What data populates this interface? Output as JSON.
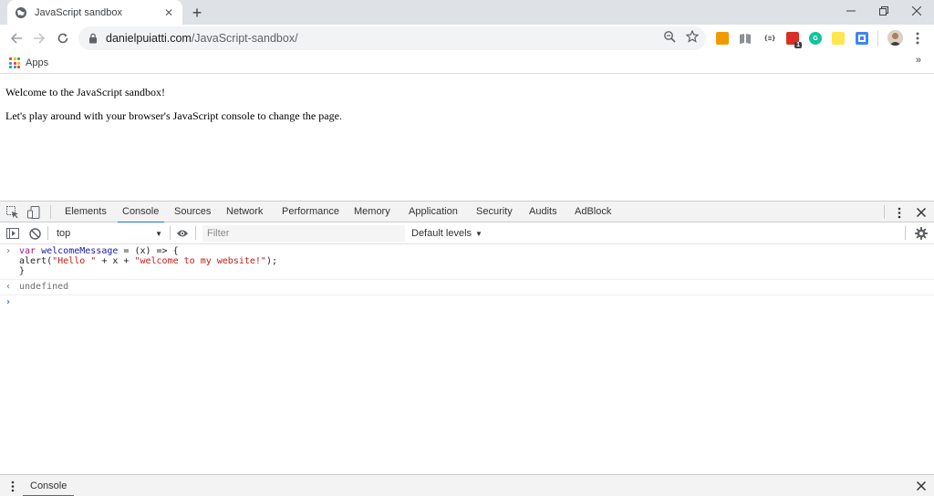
{
  "browser": {
    "tab": {
      "title": "JavaScript sandbox",
      "close": "✕"
    },
    "newtab": "+",
    "window": {
      "minimize": "—",
      "restore": "❐",
      "close": "✕"
    },
    "address": {
      "domain": "danielpuiatti.com",
      "path": "/JavaScript-sandbox/"
    },
    "bookmarks": {
      "apps_label": "Apps",
      "more": "»"
    },
    "extensions": [
      {
        "name": "orange-ext",
        "color": "#f29900",
        "text": ""
      },
      {
        "name": "book-ext",
        "color": "#9aa0a6",
        "text": ""
      },
      {
        "name": "json-ext",
        "color": "#ffffff",
        "text": "{≡}"
      },
      {
        "name": "red-ext",
        "color": "#d93025",
        "text": "1"
      },
      {
        "name": "grammarly-ext",
        "color": "#15c39a",
        "text": "G"
      },
      {
        "name": "note-ext",
        "color": "#fde74c",
        "text": ""
      },
      {
        "name": "blue-ext",
        "color": "#4285f4",
        "text": ""
      }
    ]
  },
  "page": {
    "line1": "Welcome to the JavaScript sandbox!",
    "line2": "Let's play around with your browser's JavaScript console to change the page."
  },
  "devtools": {
    "tabs": [
      "Elements",
      "Console",
      "Sources",
      "Network",
      "Performance",
      "Memory",
      "Application",
      "Security",
      "Audits",
      "AdBlock"
    ],
    "active_tab": "Console",
    "context": "top",
    "filter_placeholder": "Filter",
    "levels": "Default levels",
    "console": {
      "code_line1_var": "var",
      "code_line1_name": "welcomeMessage",
      "code_line1_rest": " = (x) => {",
      "code_line2_pre": "alert(",
      "code_line2_str1": "\"Hello \"",
      "code_line2_mid": " + x + ",
      "code_line2_str2": "\"welcome to my website!\"",
      "code_line2_post": ");",
      "code_line3": "}",
      "result": "undefined",
      "input_prompt": "›",
      "entry_prompt": "›",
      "result_prompt": "‹"
    },
    "drawer": {
      "tab": "Console",
      "close": "✕"
    }
  }
}
